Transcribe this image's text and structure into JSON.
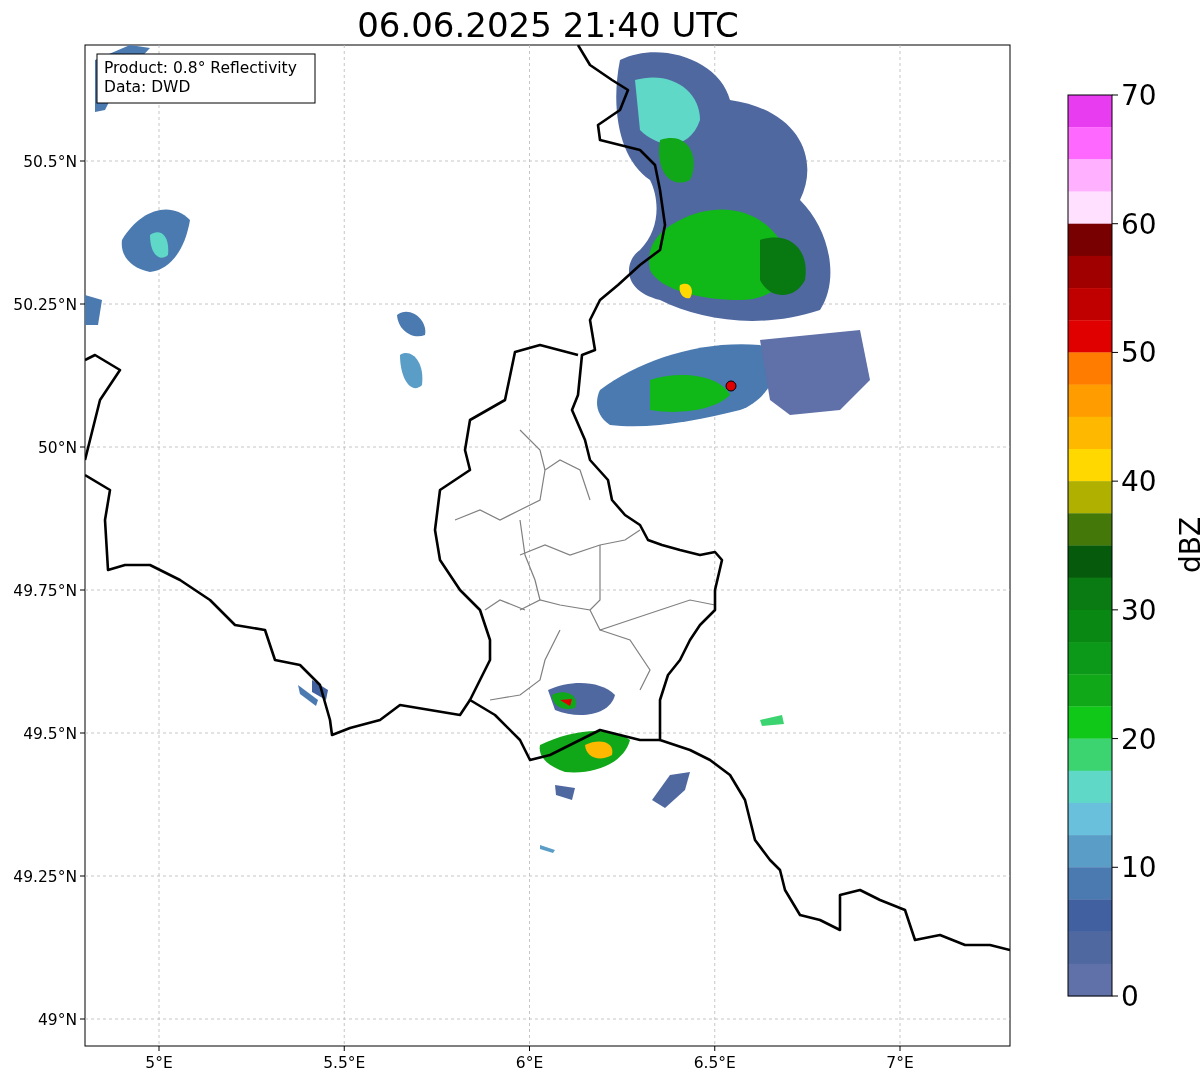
{
  "title": "06.06.2025 21:40 UTC",
  "info_box": [
    "Product: 0.8° Reflectivity",
    "Data: DWD"
  ],
  "map": {
    "lat_ticks": [
      "50.5°N",
      "50.25°N",
      "50°N",
      "49.75°N",
      "49.5°N",
      "49.25°N",
      "49°N"
    ],
    "lon_ticks": [
      "5°E",
      "5.5°E",
      "6°E",
      "6.5°E",
      "7°E"
    ]
  },
  "colorbar": {
    "label": "dBZ",
    "ticks": [
      "70",
      "60",
      "50",
      "40",
      "30",
      "20",
      "10",
      "0"
    ],
    "bands": [
      {
        "color": "#e83cf0"
      },
      {
        "color": "#ff68ff"
      },
      {
        "color": "#ffb0ff"
      },
      {
        "color": "#ffe0ff"
      },
      {
        "color": "#780000"
      },
      {
        "color": "#a00000"
      },
      {
        "color": "#c00000"
      },
      {
        "color": "#e00000"
      },
      {
        "color": "#ff7c00"
      },
      {
        "color": "#ff9c00"
      },
      {
        "color": "#ffb800"
      },
      {
        "color": "#ffd800"
      },
      {
        "color": "#b0b000"
      },
      {
        "color": "#447808"
      },
      {
        "color": "#065a0c"
      },
      {
        "color": "#0a7a12"
      },
      {
        "color": "#0a8814"
      },
      {
        "color": "#0c9818"
      },
      {
        "color": "#10a818"
      },
      {
        "color": "#10c818"
      },
      {
        "color": "#3cd470"
      },
      {
        "color": "#60d8c8"
      },
      {
        "color": "#68c0dc"
      },
      {
        "color": "#5a9ec8"
      },
      {
        "color": "#4a7ab0"
      },
      {
        "color": "#4060a0"
      },
      {
        "color": "#5068a0"
      },
      {
        "color": "#6070a8"
      }
    ]
  }
}
